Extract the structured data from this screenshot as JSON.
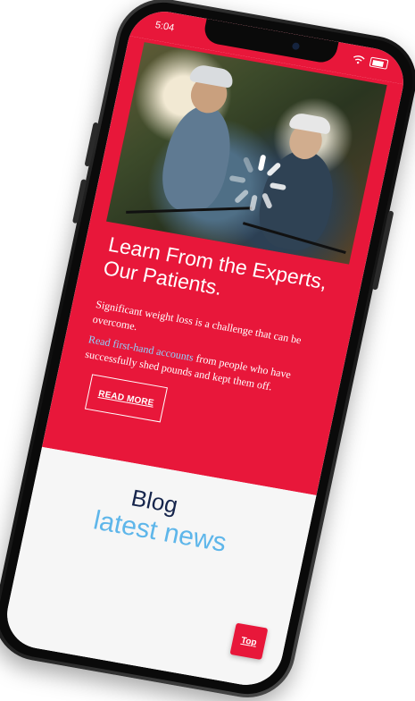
{
  "status": {
    "time": "5:04",
    "icons": [
      "wifi-icon",
      "battery-icon"
    ]
  },
  "hero": {
    "title": "Learn From the Experts, Our Patients.",
    "paragraph1": "Significant weight loss is a challenge that can be overcome.",
    "paragraph2_link": "Read first-hand accounts",
    "paragraph2_rest": " from people who have successfully shed pounds and kept them off.",
    "button_label": "READ MORE",
    "image_alt": "Two cyclists in helmets smiling outdoors"
  },
  "blog": {
    "title": "Blog",
    "subtitle": "latest news"
  },
  "top_button": {
    "label": "Top"
  },
  "colors": {
    "brand_red": "#e8173a",
    "navy": "#16254c",
    "sky_blue": "#5eb6ea",
    "link_blue": "#8fd3ff",
    "white": "#ffffff"
  }
}
